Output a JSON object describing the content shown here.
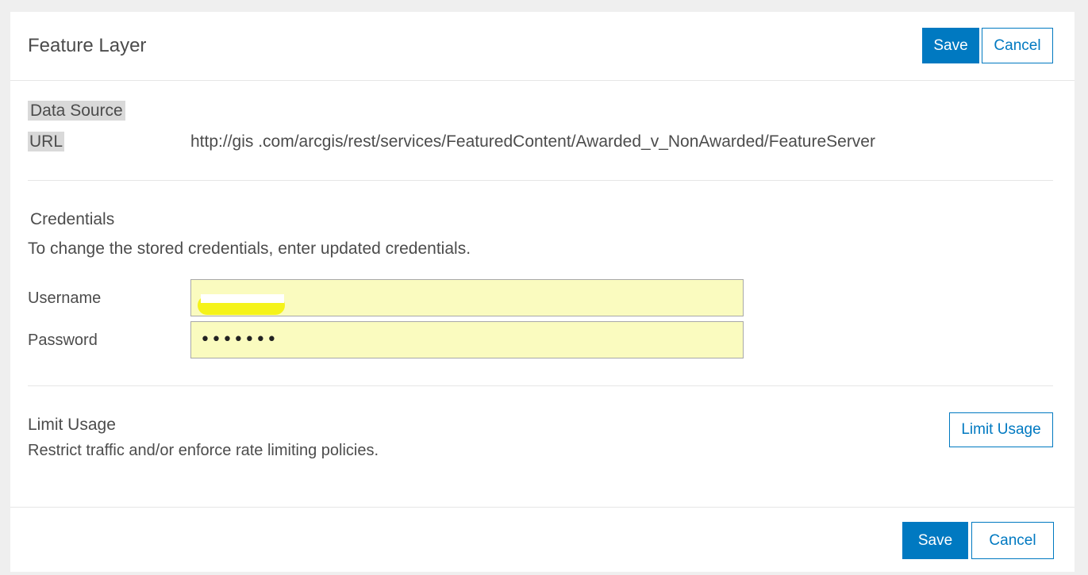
{
  "header": {
    "title": "Feature Layer",
    "save_label": "Save",
    "cancel_label": "Cancel"
  },
  "data_source": {
    "heading": "Data Source",
    "url_label": "URL",
    "url_value": "http://gis            .com/arcgis/rest/services/FeaturedContent/Awarded_v_NonAwarded/FeatureServer"
  },
  "credentials": {
    "heading": "Credentials",
    "description": "To change the stored credentials, enter updated credentials.",
    "username_label": "Username",
    "username_value": "",
    "password_label": "Password",
    "password_value": "•••••••"
  },
  "limit_usage": {
    "heading": "Limit Usage",
    "description": "Restrict traffic and/or enforce rate limiting policies.",
    "button_label": "Limit Usage"
  },
  "footer": {
    "save_label": "Save",
    "cancel_label": "Cancel"
  },
  "colors": {
    "accent": "#0079c1",
    "field_background": "#fafbbf",
    "page_background": "#efefef"
  }
}
